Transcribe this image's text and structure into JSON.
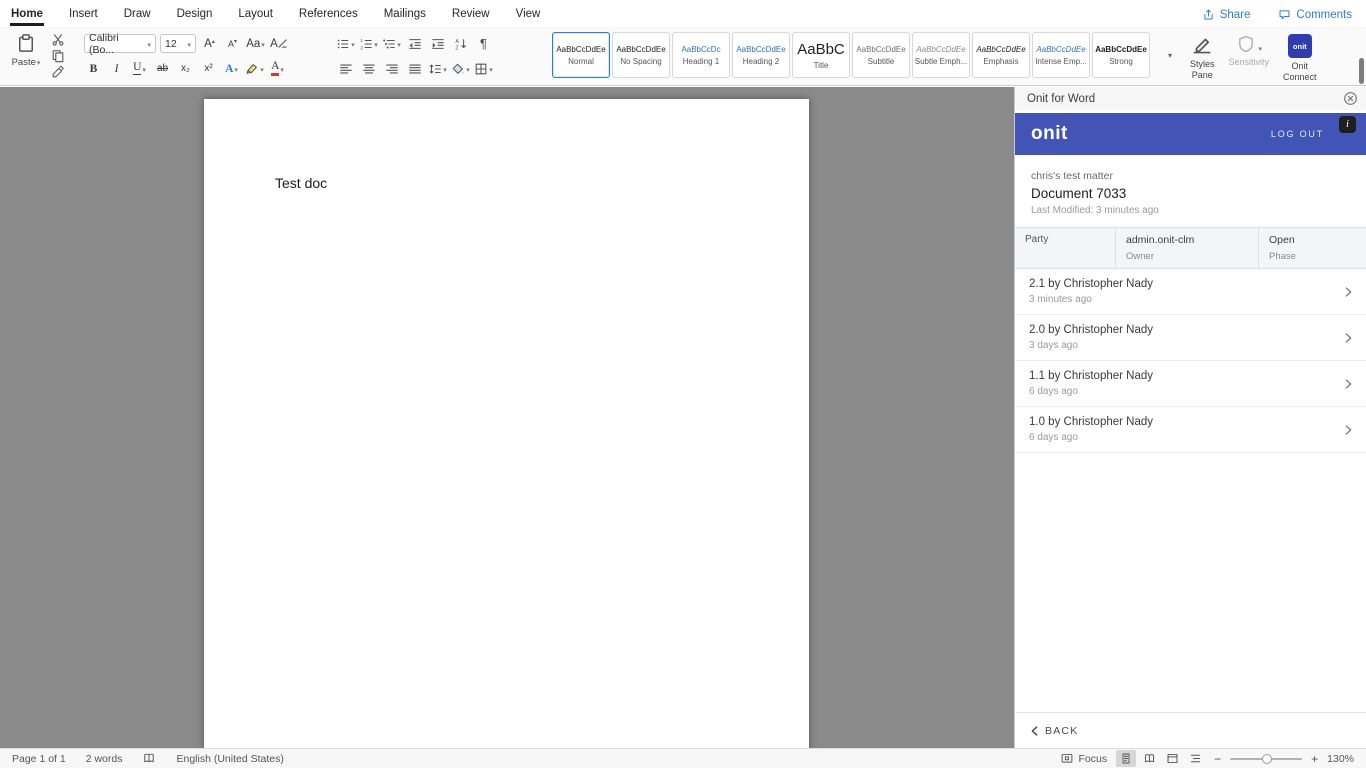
{
  "colors": {
    "accent": "#2b7cd3",
    "heading-blue": "#2e74b5",
    "banner-blue": "#4254b5",
    "logo-blue": "#2e3cb0"
  },
  "menubar": {
    "tabs": [
      "Home",
      "Insert",
      "Draw",
      "Design",
      "Layout",
      "References",
      "Mailings",
      "Review",
      "View"
    ],
    "share": "Share",
    "comments": "Comments"
  },
  "ribbon": {
    "paste_label": "Paste",
    "font_name": "Calibri (Bo...",
    "font_size": "12",
    "grow_font": "A",
    "shrink_font": "A",
    "change_case": "Aa",
    "clear_format": "A",
    "bold": "B",
    "italic": "I",
    "underline": "U",
    "strike": "ab",
    "subscript": "x₂",
    "superscript": "x²",
    "text_effects": "A",
    "font_color": "A",
    "pilcrow": "¶",
    "styles": [
      {
        "sample": "AaBbCcDdEe",
        "label": "Normal"
      },
      {
        "sample": "AaBbCcDdEe",
        "label": "No Spacing"
      },
      {
        "sample": "AaBbCcDc",
        "label": "Heading 1"
      },
      {
        "sample": "AaBbCcDdEe",
        "label": "Heading 2"
      },
      {
        "sample": "AaBbC",
        "label": "Title"
      },
      {
        "sample": "AaBbCcDdEe",
        "label": "Subtitle"
      },
      {
        "sample": "AaBbCcDdEe",
        "label": "Subtle Emph..."
      },
      {
        "sample": "AaBbCcDdEe",
        "label": "Emphasis"
      },
      {
        "sample": "AaBbCcDdEe",
        "label": "Intense Emp..."
      },
      {
        "sample": "AaBbCcDdEe",
        "label": "Strong"
      }
    ],
    "styles_pane": "Styles\nPane",
    "sensitivity": "Sensitivity",
    "onit_connect": "Onit\nConnect",
    "onit_logo": "onit"
  },
  "document": {
    "text": "Test doc"
  },
  "panel": {
    "title": "Onit for Word",
    "logo": "onit",
    "logout": "LOG OUT",
    "info": "i",
    "matter": "chris's test matter",
    "doc_title": "Document 7033",
    "last_modified": "Last Modified: 3 minutes ago",
    "table": {
      "party_label": "Party",
      "owner_value": "admin.onit-clm",
      "owner_label": "Owner",
      "phase_value": "Open",
      "phase_label": "Phase"
    },
    "versions": [
      {
        "title": "2.1 by Christopher Nady",
        "time": "3 minutes ago"
      },
      {
        "title": "2.0 by Christopher Nady",
        "time": "3 days ago"
      },
      {
        "title": "1.1 by Christopher Nady",
        "time": "6 days ago"
      },
      {
        "title": "1.0 by Christopher Nady",
        "time": "6 days ago"
      }
    ],
    "back": "BACK"
  },
  "statusbar": {
    "page": "Page 1 of 1",
    "words": "2 words",
    "language": "English (United States)",
    "focus": "Focus",
    "zoom_out": "−",
    "zoom_in": "+",
    "zoom": "130%"
  }
}
